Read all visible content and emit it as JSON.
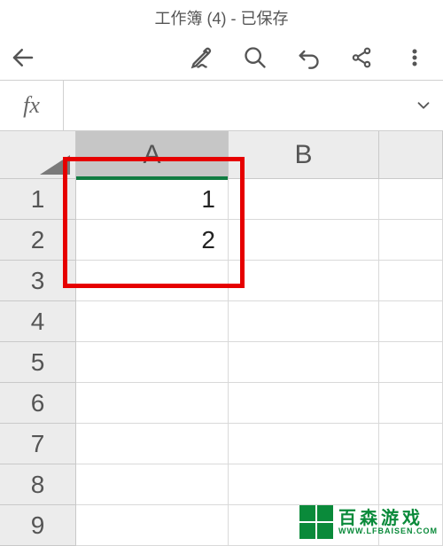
{
  "titlebar": {
    "title": "工作簿 (4) - 已保存"
  },
  "toolbar": {
    "back_icon": "back-arrow",
    "pen_icon": "pen-icon",
    "search_icon": "search-icon",
    "undo_icon": "undo-icon",
    "share_icon": "share-icon",
    "more_icon": "more-icon"
  },
  "fxbar": {
    "label": "fx",
    "value": "",
    "chevron": "chevron-down-icon"
  },
  "grid": {
    "columns": [
      "A",
      "B"
    ],
    "selected_column": "A",
    "rows": [
      {
        "num": "1",
        "A": "1",
        "B": ""
      },
      {
        "num": "2",
        "A": "2",
        "B": ""
      },
      {
        "num": "3",
        "A": "",
        "B": ""
      },
      {
        "num": "4",
        "A": "",
        "B": ""
      },
      {
        "num": "5",
        "A": "",
        "B": ""
      },
      {
        "num": "6",
        "A": "",
        "B": ""
      },
      {
        "num": "7",
        "A": "",
        "B": ""
      },
      {
        "num": "8",
        "A": "",
        "B": ""
      },
      {
        "num": "9",
        "A": "",
        "B": ""
      }
    ]
  },
  "annotation": {
    "highlight_color": "#e60000",
    "covers": [
      "A:header",
      "A1",
      "A2"
    ]
  },
  "watermark": {
    "cn": "百森游戏",
    "en": "WWW.LFBAISEN.COM"
  }
}
